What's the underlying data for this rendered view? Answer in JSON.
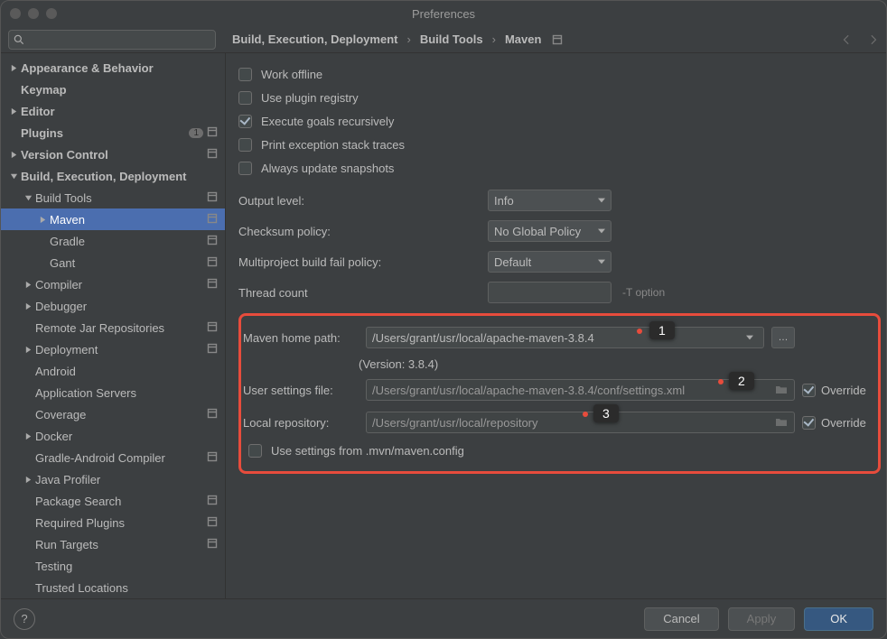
{
  "title": "Preferences",
  "search": {
    "placeholder": ""
  },
  "breadcrumb": [
    "Build, Execution, Deployment",
    "Build Tools",
    "Maven"
  ],
  "sidebar": {
    "items": [
      {
        "label": "Appearance & Behavior",
        "bold": true,
        "depth": 0,
        "exp": "closed",
        "ind": false
      },
      {
        "label": "Keymap",
        "bold": true,
        "depth": 0,
        "exp": "none",
        "ind": false
      },
      {
        "label": "Editor",
        "bold": true,
        "depth": 0,
        "exp": "closed",
        "ind": false
      },
      {
        "label": "Plugins",
        "bold": true,
        "depth": 0,
        "exp": "none",
        "ind": true,
        "badge": "1"
      },
      {
        "label": "Version Control",
        "bold": true,
        "depth": 0,
        "exp": "closed",
        "ind": true
      },
      {
        "label": "Build, Execution, Deployment",
        "bold": true,
        "depth": 0,
        "exp": "open",
        "ind": false
      },
      {
        "label": "Build Tools",
        "bold": false,
        "depth": 1,
        "exp": "open",
        "ind": true
      },
      {
        "label": "Maven",
        "bold": false,
        "depth": 2,
        "exp": "closed",
        "ind": true,
        "sel": true
      },
      {
        "label": "Gradle",
        "bold": false,
        "depth": 2,
        "exp": "none",
        "ind": true
      },
      {
        "label": "Gant",
        "bold": false,
        "depth": 2,
        "exp": "none",
        "ind": true
      },
      {
        "label": "Compiler",
        "bold": false,
        "depth": 1,
        "exp": "closed",
        "ind": true
      },
      {
        "label": "Debugger",
        "bold": false,
        "depth": 1,
        "exp": "closed",
        "ind": false
      },
      {
        "label": "Remote Jar Repositories",
        "bold": false,
        "depth": 1,
        "exp": "none",
        "ind": true
      },
      {
        "label": "Deployment",
        "bold": false,
        "depth": 1,
        "exp": "closed",
        "ind": true
      },
      {
        "label": "Android",
        "bold": false,
        "depth": 1,
        "exp": "none",
        "ind": false
      },
      {
        "label": "Application Servers",
        "bold": false,
        "depth": 1,
        "exp": "none",
        "ind": false
      },
      {
        "label": "Coverage",
        "bold": false,
        "depth": 1,
        "exp": "none",
        "ind": true
      },
      {
        "label": "Docker",
        "bold": false,
        "depth": 1,
        "exp": "closed",
        "ind": false
      },
      {
        "label": "Gradle-Android Compiler",
        "bold": false,
        "depth": 1,
        "exp": "none",
        "ind": true
      },
      {
        "label": "Java Profiler",
        "bold": false,
        "depth": 1,
        "exp": "closed",
        "ind": false
      },
      {
        "label": "Package Search",
        "bold": false,
        "depth": 1,
        "exp": "none",
        "ind": true
      },
      {
        "label": "Required Plugins",
        "bold": false,
        "depth": 1,
        "exp": "none",
        "ind": true
      },
      {
        "label": "Run Targets",
        "bold": false,
        "depth": 1,
        "exp": "none",
        "ind": true
      },
      {
        "label": "Testing",
        "bold": false,
        "depth": 1,
        "exp": "none",
        "ind": false
      },
      {
        "label": "Trusted Locations",
        "bold": false,
        "depth": 1,
        "exp": "none",
        "ind": false
      }
    ]
  },
  "checks": {
    "work_offline": "Work offline",
    "use_plugin_registry": "Use plugin registry",
    "execute_goals": "Execute goals recursively",
    "print_exception": "Print exception stack traces",
    "always_update": "Always update snapshots"
  },
  "form": {
    "output_level_label": "Output level:",
    "output_level_value": "Info",
    "checksum_label": "Checksum policy:",
    "checksum_value": "No Global Policy",
    "fail_label": "Multiproject build fail policy:",
    "fail_value": "Default",
    "thread_label": "Thread count",
    "thread_value": "",
    "thread_hint": "-T option"
  },
  "maven": {
    "home_label": "Maven home path:",
    "home_value": "/Users/grant/usr/local/apache-maven-3.8.4",
    "version": "(Version: 3.8.4)",
    "settings_label": "User settings file:",
    "settings_value": "/Users/grant/usr/local/apache-maven-3.8.4/conf/settings.xml",
    "repo_label": "Local repository:",
    "repo_value": "/Users/grant/usr/local/repository",
    "mvnconfig": "Use settings from .mvn/maven.config",
    "override": "Override"
  },
  "annotations": {
    "one": "1",
    "two": "2",
    "three": "3"
  },
  "buttons": {
    "cancel": "Cancel",
    "apply": "Apply",
    "ok": "OK"
  }
}
